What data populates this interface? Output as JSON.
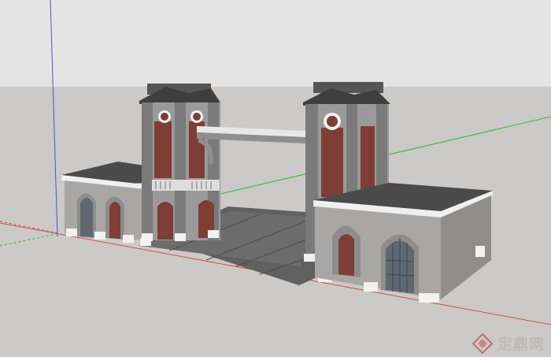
{
  "viewport": {
    "sky_color": "#e4e4e4",
    "ground_color": "#cbcac8",
    "axis_colors": {
      "red": "#d94a4a",
      "green": "#36b936",
      "blue": "#5050d8"
    }
  },
  "model": {
    "brick_color": "#7e3e35",
    "stone_color": "#9d9d9d",
    "dark_stone_color": "#6f6f6f",
    "roof_color": "#444444",
    "trim_color": "#f2f2f2",
    "window_color": "#5f6770",
    "plaza_color": "#5e5e5e"
  },
  "watermark": {
    "text": "定鼎网",
    "icon": "diamond-logo-icon"
  }
}
